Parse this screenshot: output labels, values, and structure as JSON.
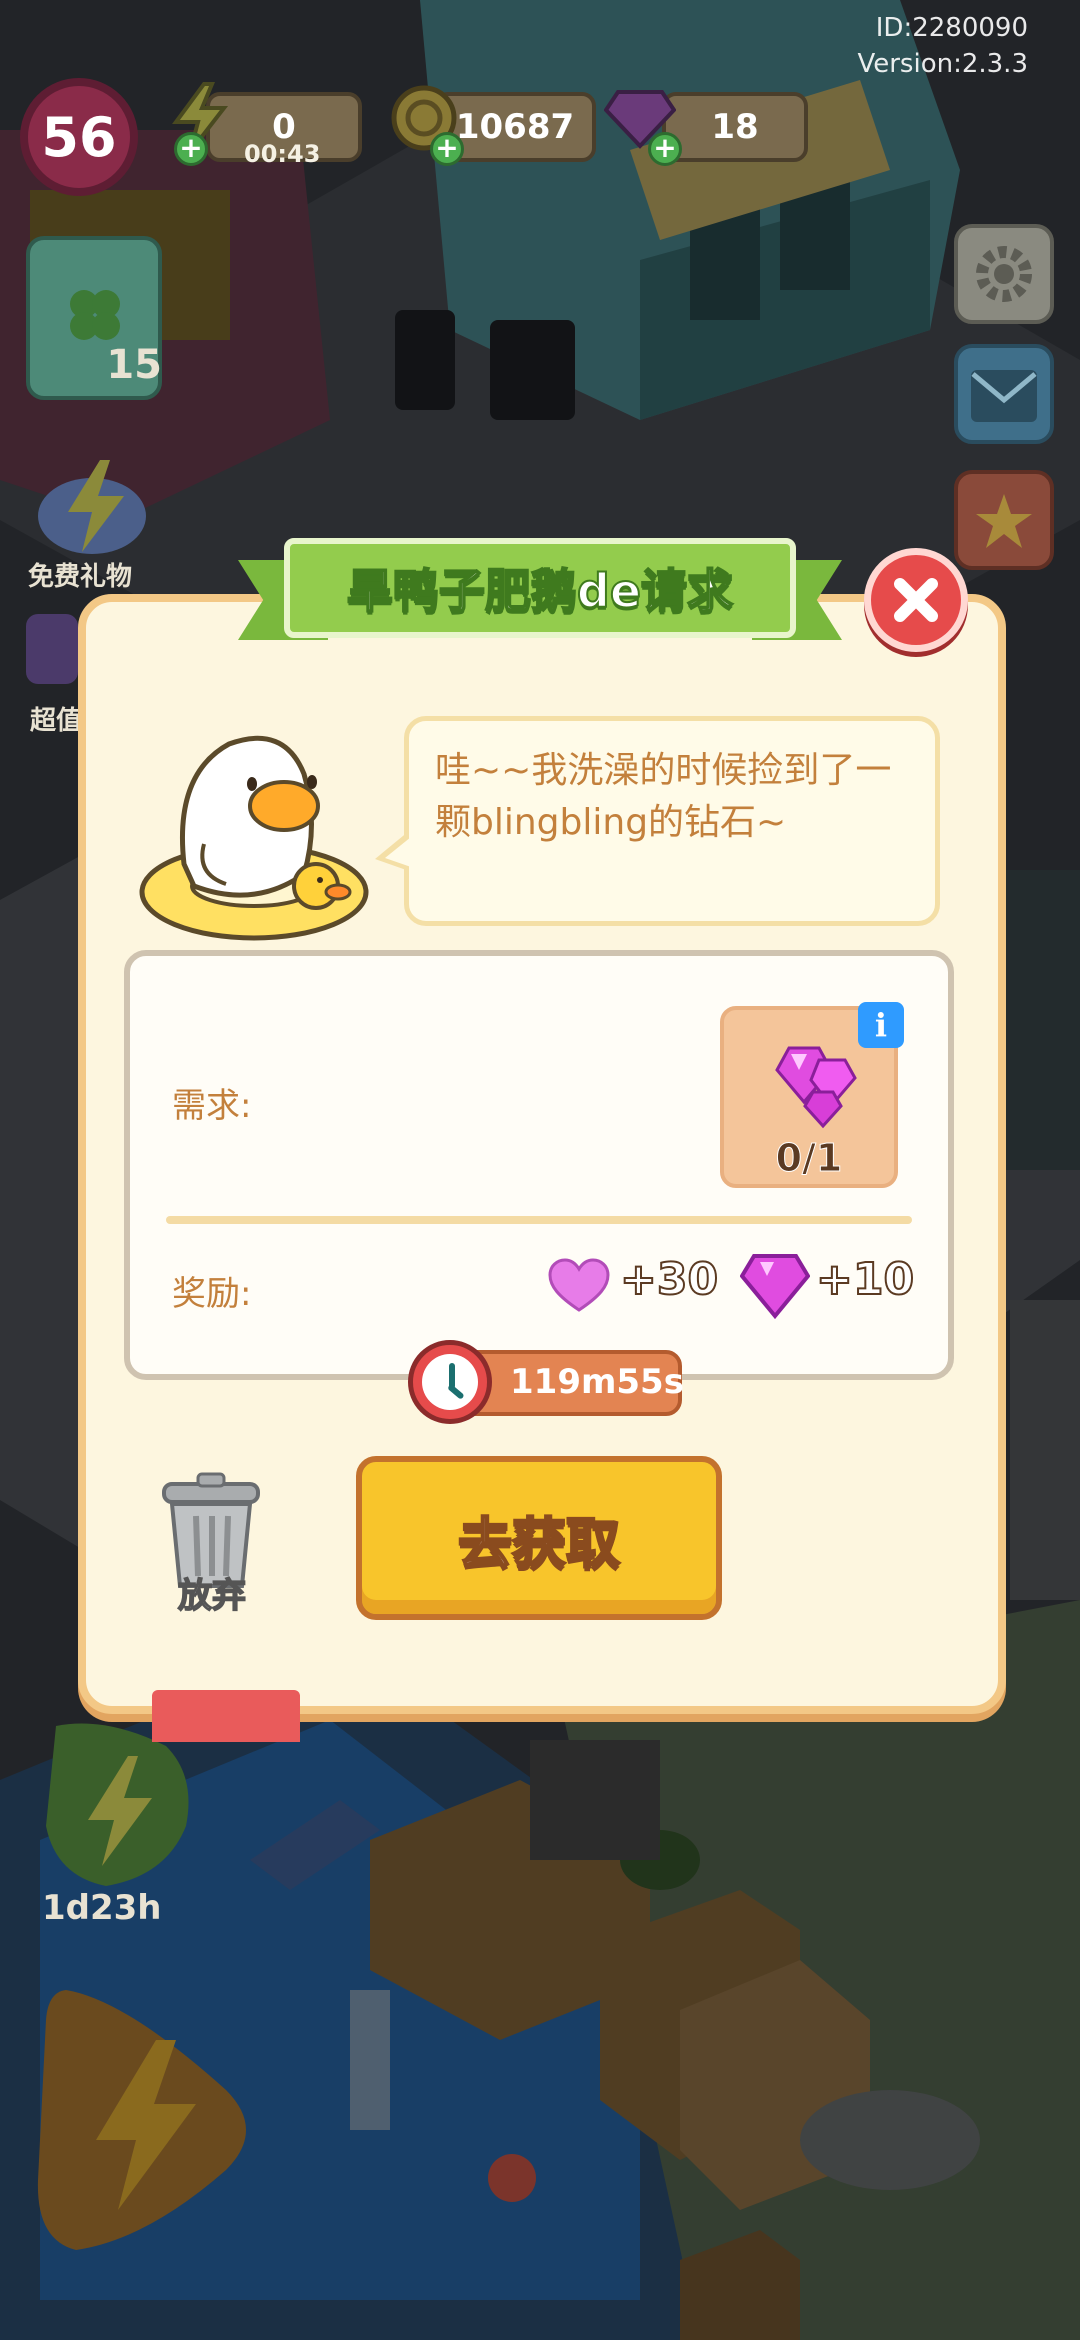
{
  "hud": {
    "id_text": "ID:2280090",
    "version_text": "Version:2.3.3",
    "level": "56",
    "energy": "0",
    "energy_timer": "00:43",
    "coins": "10687",
    "gems": "18",
    "task_count": "15"
  },
  "side": {
    "free_gift_label": "免费礼物",
    "super_label": "超值",
    "bottom_timer": "1d23h"
  },
  "dialog": {
    "title": "旱鸭子肥鹅de请求",
    "speech": "哇~~我洗澡的时候捡到了一颗blingbling的钻石~",
    "requirement_label": "需求:",
    "requirement_item": "gem-icon",
    "requirement_progress": "0/1",
    "info_badge": "i",
    "reward_label": "奖励:",
    "rewards": [
      {
        "icon": "heart-icon",
        "value": "+30"
      },
      {
        "icon": "gem-icon",
        "value": "+10"
      }
    ],
    "timer": "119m55s",
    "abandon_label": "放弃",
    "go_button_label": "去获取"
  },
  "colors": {
    "dialog_bg": "#fdf6df",
    "dialog_border": "#f3c886",
    "ribbon_green": "#93cc4d",
    "go_button": "#f8c52b",
    "close_red": "#e64b4b",
    "text_brown": "#c3803c"
  }
}
